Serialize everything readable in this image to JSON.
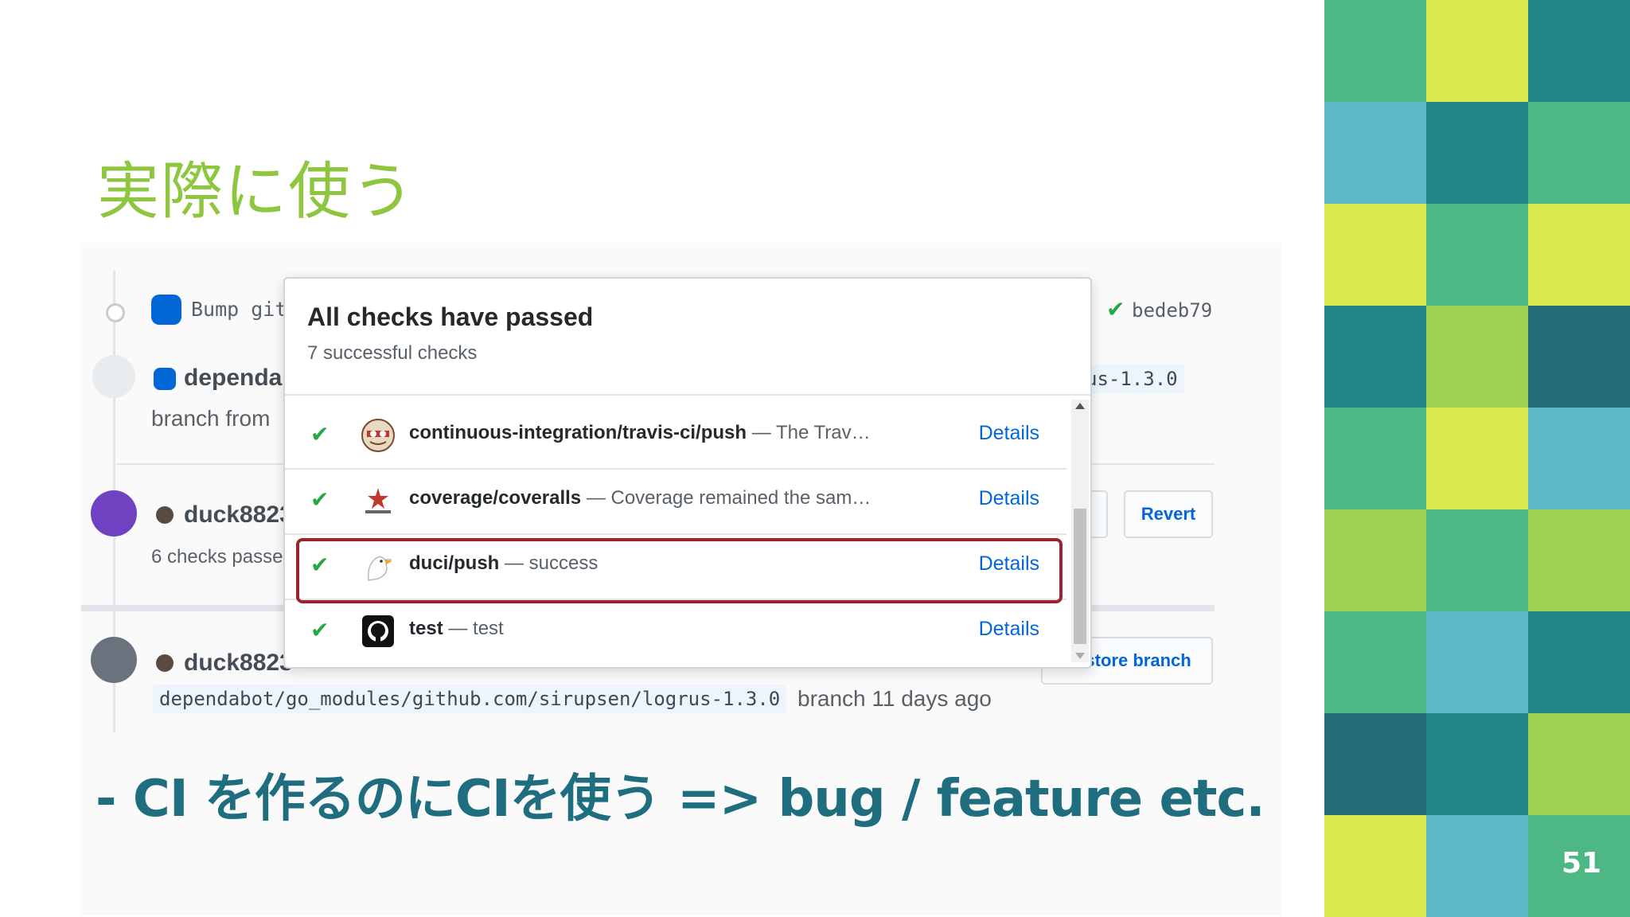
{
  "slide": {
    "title": "実際に使う",
    "bottom_text": "- CI を作るのにCIを使う => bug / feature etc.",
    "page_number": "51"
  },
  "background": {
    "commit_msg": "Bump git",
    "commit_sha": "bedeb79",
    "author1": "dependab",
    "branch_from": "branch from",
    "branch_tag": "us-1.3.0",
    "author2": "duck8823",
    "checks_passed": "6 checks passe",
    "revert": "Revert",
    "author3": "duck8823",
    "deleted_branch": "dependabot/go_modules/github.com/sirupsen/logrus-1.3.0",
    "branch_age": "branch 11 days ago",
    "restore_branch": "Restore branch"
  },
  "popup": {
    "title": "All checks have passed",
    "subtitle": "7 successful checks",
    "checks": [
      {
        "name": "continuous-integration/travis-ci/push",
        "desc": "— The Trav…",
        "details": "Details",
        "icon": "travis-icon"
      },
      {
        "name": "coverage/coveralls",
        "desc": "— Coverage remained the sam…",
        "details": "Details",
        "icon": "coveralls-icon"
      },
      {
        "name": "duci/push",
        "desc": "— success",
        "details": "Details",
        "icon": "duci-icon"
      },
      {
        "name": "test",
        "desc": "— test",
        "details": "Details",
        "icon": "github-icon"
      }
    ]
  },
  "colors": {
    "title_green": "#8ec63f",
    "bottom_teal": "#1f6e80",
    "highlight_red": "#9c2430",
    "link_blue": "#0366d6",
    "check_green": "#28a745"
  }
}
